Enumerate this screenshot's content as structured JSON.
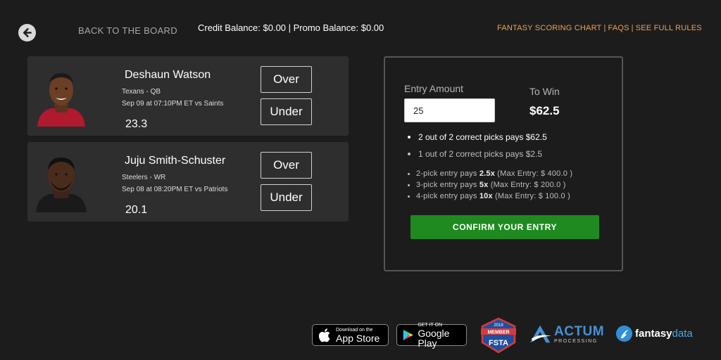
{
  "header": {
    "back_label": "BACK TO THE BOARD",
    "balance_text": "Credit Balance: $0.00 | Promo Balance: $0.00",
    "links": [
      "FANTASY SCORING CHART",
      "FAQS",
      "SEE FULL RULES"
    ]
  },
  "players": [
    {
      "name": "Deshaun Watson",
      "team": "Texans - QB",
      "game": "Sep 09 at 07:10PM ET vs Saints",
      "projection": "23.3",
      "over_label": "Over",
      "under_label": "Under",
      "jersey_color": "#b0192e"
    },
    {
      "name": "Juju Smith-Schuster",
      "team": "Steelers - WR",
      "game": "Sep 08 at 08:20PM ET vs Patriots",
      "projection": "20.1",
      "over_label": "Over",
      "under_label": "Under",
      "jersey_color": "#1a1a1a"
    }
  ],
  "entry": {
    "amount_label": "Entry Amount",
    "amount_value": "25",
    "towin_label": "To Win",
    "towin_value": "$62.5",
    "payouts": [
      "2 out of 2 correct picks pays $62.5",
      "1 out of 2 correct picks pays $2.5"
    ],
    "multipliers": [
      {
        "prefix": "2-pick entry pays ",
        "mult": "2.5x",
        "suffix": " (Max Entry: $ 400.0 )"
      },
      {
        "prefix": "3-pick entry pays ",
        "mult": "5x",
        "suffix": " (Max Entry: $ 200.0 )"
      },
      {
        "prefix": "4-pick entry pays ",
        "mult": "10x",
        "suffix": " (Max Entry: $ 100.0 )"
      }
    ],
    "confirm_label": "CONFIRM YOUR ENTRY"
  },
  "footer": {
    "apple_small": "Download on the",
    "apple_big": "App Store",
    "google_small": "GET IT ON",
    "google_big": "Google Play",
    "fsta_top": "MEMBER",
    "fsta_year": "2018",
    "fsta_name": "FSTA",
    "actum_name": "ACTUM",
    "actum_sub": "PROCESSING",
    "fdata_a": "fantasy",
    "fdata_b": "data"
  },
  "colors": {
    "accent_orange": "#e8a35a",
    "confirm_green": "#1f8a1f",
    "actum_blue": "#4a8fd6"
  },
  "icons": [
    "back-arrow-icon",
    "apple-icon",
    "google-play-icon",
    "fsta-badge",
    "actum-logo-icon",
    "fantasydata-logo-icon"
  ]
}
